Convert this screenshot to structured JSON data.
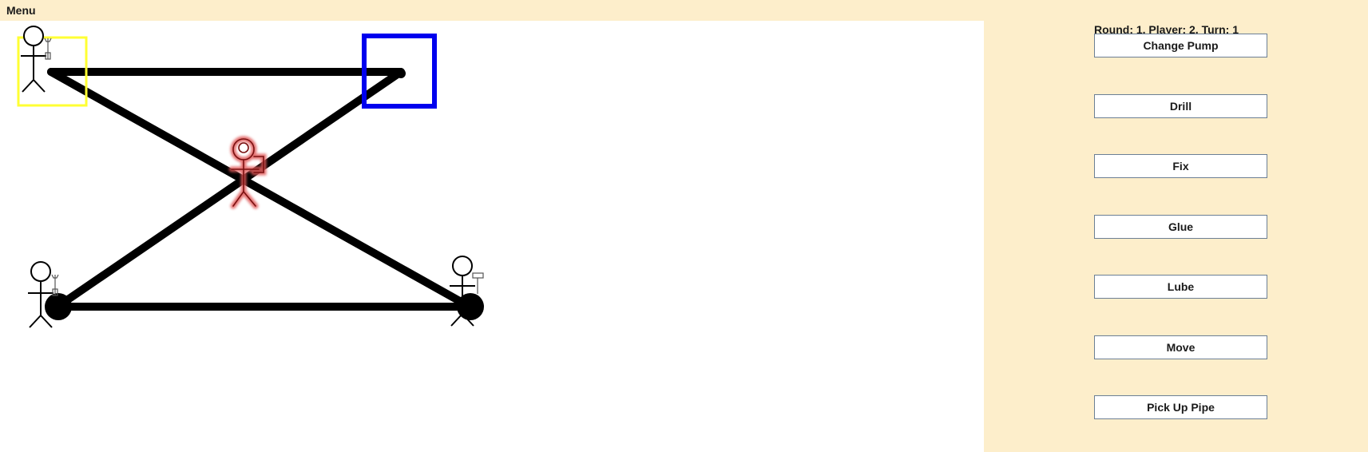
{
  "menu": {
    "label": "Menu"
  },
  "status": {
    "text": "Round: 1, Player: 2, Turn: 1"
  },
  "actions": [
    {
      "label": "Change Pump"
    },
    {
      "label": "Drill"
    },
    {
      "label": "Fix"
    },
    {
      "label": "Glue"
    },
    {
      "label": "Lube"
    },
    {
      "label": "Move"
    },
    {
      "label": "Pick Up Pipe"
    }
  ],
  "colors": {
    "panel_background": "#fdeecb",
    "board_background": "#ffffff",
    "pipe": "#000000",
    "selected_source": "#ffff33",
    "selected_target": "#0000ee",
    "active_player_glow": "#e05a5a"
  },
  "board": {
    "nodes": [
      {
        "id": "top-left",
        "kind": "source"
      },
      {
        "id": "top-right",
        "kind": "pump"
      },
      {
        "id": "bottom-left",
        "kind": "junction"
      },
      {
        "id": "bottom-right",
        "kind": "junction"
      }
    ],
    "pipes": [
      {
        "from": "top-left",
        "to": "top-right"
      },
      {
        "from": "top-left",
        "to": "bottom-right"
      },
      {
        "from": "bottom-left",
        "to": "top-right"
      },
      {
        "from": "bottom-left",
        "to": "bottom-right"
      }
    ],
    "characters": [
      {
        "id": "player-top-left",
        "tool": "wrench-icon",
        "active": false
      },
      {
        "id": "player-center",
        "tool": "flag-icon",
        "active": true
      },
      {
        "id": "player-bottom-left",
        "tool": "wrench-icon",
        "active": false
      },
      {
        "id": "player-bottom-right",
        "tool": "hammer-icon",
        "active": false
      }
    ]
  }
}
